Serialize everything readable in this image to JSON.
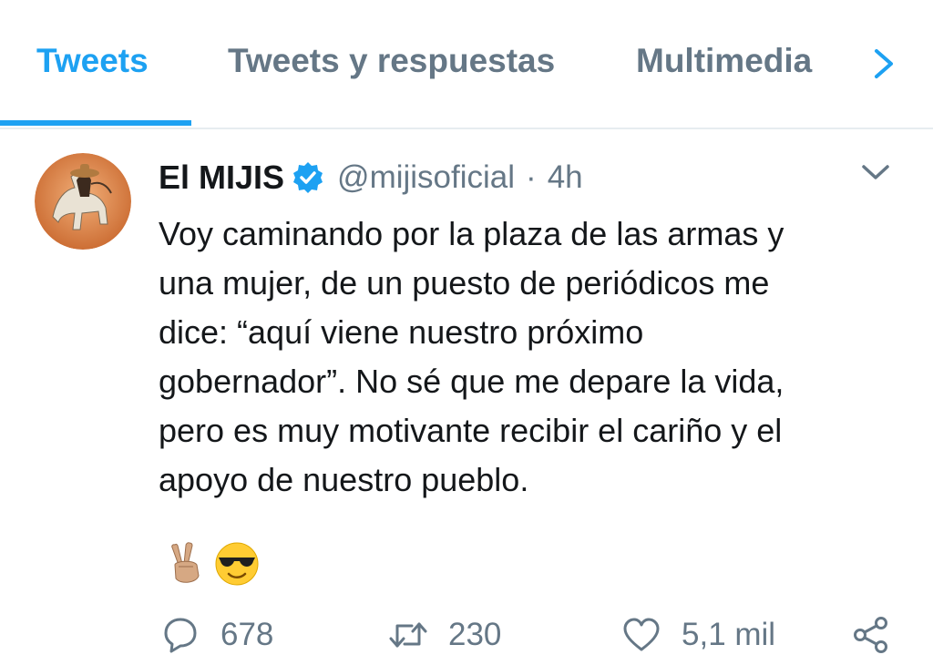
{
  "tabs": {
    "items": [
      "Tweets",
      "Tweets y respuestas",
      "Multimedia"
    ],
    "active_index": 0
  },
  "tweet": {
    "display_name": "El MIJIS",
    "handle": "@mijisoficial",
    "separator": "·",
    "time": "4h",
    "verified": true,
    "text_lines": [
      "Voy caminando por la plaza de las armas y",
      "una mujer, de un puesto de periódicos me",
      "dice: “aquí viene nuestro próximo",
      "gobernador”.  No sé que me depare la vida,",
      "pero es muy motivante recibir el cariño y el",
      "apoyo de nuestro pueblo."
    ],
    "emojis": [
      "✌🏼",
      "😎"
    ],
    "actions": {
      "replies": "678",
      "retweets": "230",
      "likes": "5,1 mil"
    }
  },
  "colors": {
    "accent": "#1da1f2",
    "secondary_text": "#657786",
    "primary_text": "#14171a",
    "divider": "#e6ecf0"
  },
  "icons": [
    "chevron-right-icon",
    "verified-badge-icon",
    "chevron-down-icon",
    "reply-icon",
    "retweet-icon",
    "like-icon",
    "share-icon"
  ]
}
